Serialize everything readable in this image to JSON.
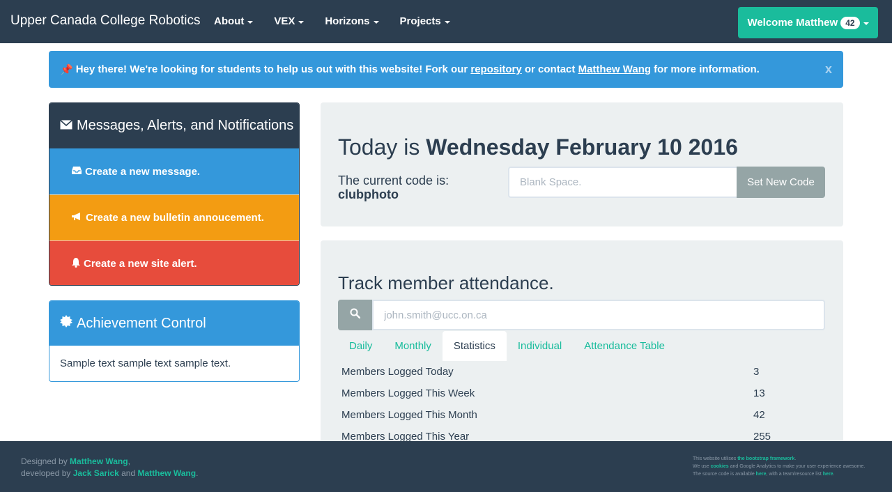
{
  "navbar": {
    "brand": "Upper Canada College Robotics",
    "menu": [
      {
        "label": "About"
      },
      {
        "label": "VEX"
      },
      {
        "label": "Horizons"
      },
      {
        "label": "Projects"
      }
    ],
    "welcome": {
      "label": "Welcome Matthew",
      "badge": "42"
    }
  },
  "alert": {
    "icon": "pushpin-icon",
    "lead": "Hey there!",
    "text1": " We're looking for students to help us out with this website! Fork our ",
    "link1": "repository",
    "text2": " or contact ",
    "link2": "Matthew Wang",
    "text3": " for more information.",
    "close": "x"
  },
  "messages_panel": {
    "title": "Messages, Alerts, and Notifications",
    "items": [
      {
        "label": "Create a new message.",
        "icon": "inbox-icon",
        "color": "#3498db"
      },
      {
        "label": "Create a new bulletin annoucement.",
        "icon": "bullhorn-icon",
        "color": "#f39c12"
      },
      {
        "label": "Create a new site alert.",
        "icon": "bell-icon",
        "color": "#e74c3c"
      }
    ]
  },
  "achievement_panel": {
    "title": "Achievement Control",
    "body": "Sample text sample text sample text."
  },
  "today": {
    "prefix": "Today is ",
    "date": "Wednesday February 10 2016",
    "code_label": "The current code is:",
    "code_value": "clubphoto",
    "input_placeholder": "Blank Space.",
    "button": "Set New Code"
  },
  "attendance": {
    "title": "Track member attendance.",
    "search_placeholder": "john.smith@ucc.on.ca",
    "tabs": [
      {
        "label": "Daily",
        "active": false
      },
      {
        "label": "Monthly",
        "active": false
      },
      {
        "label": "Statistics",
        "active": true
      },
      {
        "label": "Individual",
        "active": false
      },
      {
        "label": "Attendance Table",
        "active": false
      }
    ],
    "stats": [
      {
        "label": "Members Logged Today",
        "value": "3"
      },
      {
        "label": "Members Logged This Week",
        "value": "13"
      },
      {
        "label": "Members Logged This Month",
        "value": "42"
      },
      {
        "label": "Members Logged This Year",
        "value": "255"
      }
    ]
  },
  "footer": {
    "designed_by": "Designed by ",
    "designer": "Matthew Wang",
    "comma": ",",
    "developed_by": "developed by ",
    "dev1": "Jack Sarick",
    "and": " and ",
    "dev2": "Matthew Wang",
    "period": ".",
    "right_line1_text": "This website utilises ",
    "right_line1_link": "the bootstrap framework",
    "right_line1_end": ".",
    "right_line2_text": "We use ",
    "right_line2_link": "cookies",
    "right_line2_end": " and Google Analytics to make your user experience awesome.",
    "right_line3_text": "The source code is available ",
    "right_line3_link1": "here",
    "right_line3_mid": ", with a team/resource list ",
    "right_line3_link2": "here",
    "right_line3_end": "."
  },
  "colors": {
    "primary": "#2c3e50",
    "success": "#1abc9c",
    "info": "#3498db",
    "warning": "#f39c12",
    "danger": "#e74c3c",
    "well": "#ecf0f1"
  }
}
